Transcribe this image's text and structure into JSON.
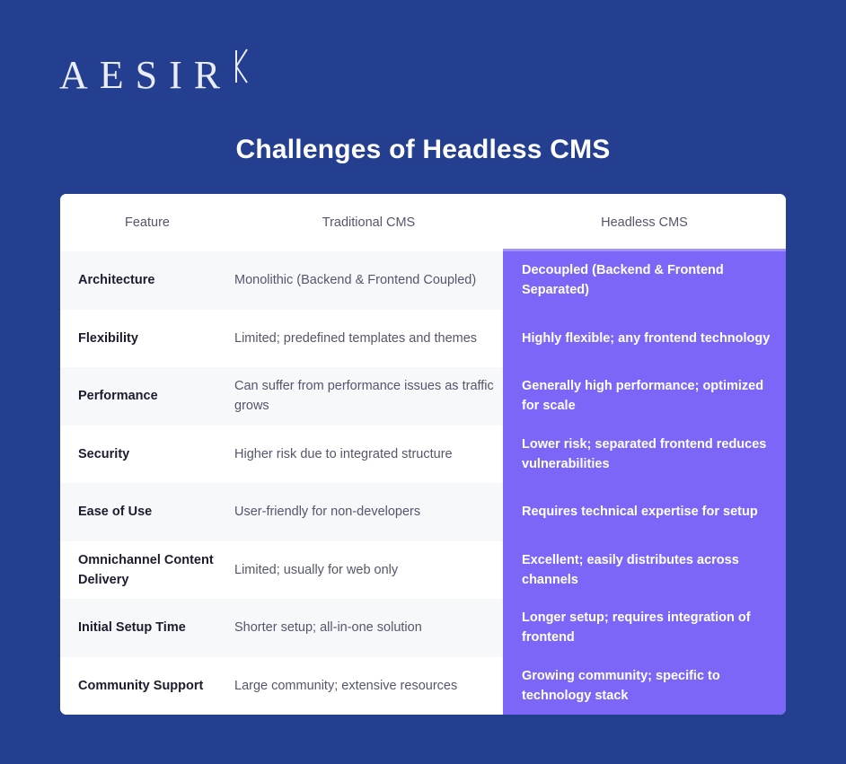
{
  "brand": {
    "wordmark": "AESIR",
    "rune_icon": "aesir-rune-mark"
  },
  "header": {
    "title": "Challenges of Headless CMS"
  },
  "colors": {
    "background": "#243F8F",
    "card": "#FFFFFF",
    "row_alt": "#F7F8FA",
    "accent_purple": "#7B66F7",
    "feature_text": "#1C1C2E",
    "body_text": "#55566B",
    "title_text": "#FFFFFF"
  },
  "table": {
    "columns": [
      {
        "key": "feature",
        "label": "Feature"
      },
      {
        "key": "traditional",
        "label": "Traditional CMS"
      },
      {
        "key": "headless",
        "label": "Headless CMS"
      }
    ],
    "rows": [
      {
        "feature": "Architecture",
        "traditional": "Monolithic (Backend & Frontend Coupled)",
        "headless": "Decoupled (Backend & Frontend Separated)"
      },
      {
        "feature": "Flexibility",
        "traditional": "Limited; predefined templates and themes",
        "headless": "Highly flexible; any frontend technology"
      },
      {
        "feature": "Performance",
        "traditional": "Can suffer from performance issues as traffic grows",
        "headless": "Generally high performance; optimized for scale"
      },
      {
        "feature": "Security",
        "traditional": "Higher risk due to integrated structure",
        "headless": "Lower risk; separated frontend reduces vulnerabilities"
      },
      {
        "feature": "Ease of Use",
        "traditional": "User-friendly for non-developers",
        "headless": "Requires technical expertise for setup"
      },
      {
        "feature": "Omnichannel Content Delivery",
        "traditional": "Limited; usually for web only",
        "headless": "Excellent; easily distributes across channels"
      },
      {
        "feature": "Initial Setup Time",
        "traditional": "Shorter setup; all-in-one solution",
        "headless": "Longer setup; requires integration of frontend"
      },
      {
        "feature": "Community Support",
        "traditional": "Large community; extensive resources",
        "headless": "Growing community; specific to technology stack"
      }
    ]
  }
}
